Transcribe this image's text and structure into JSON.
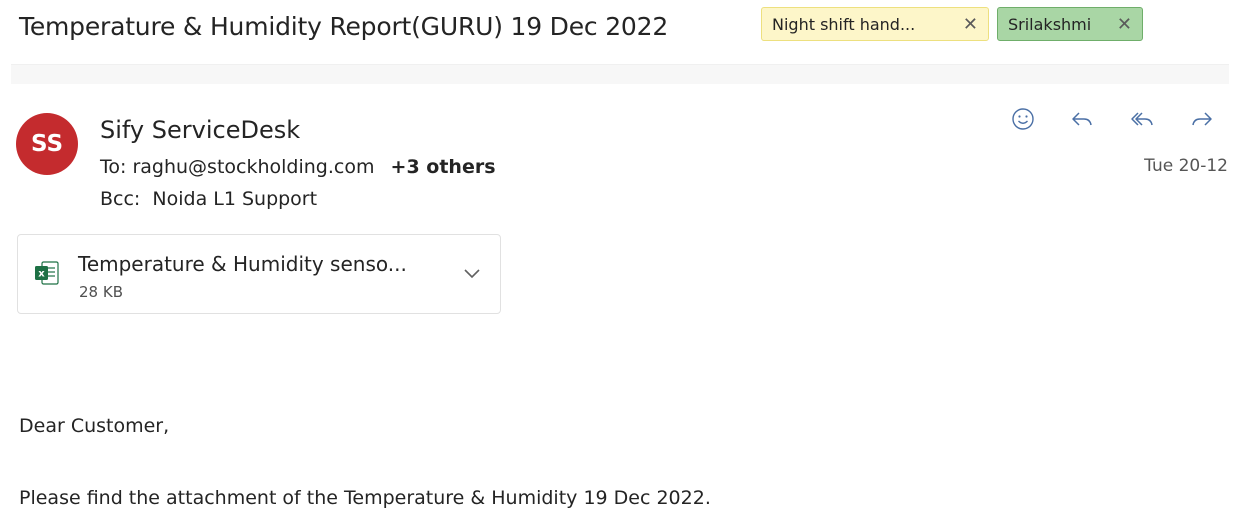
{
  "email": {
    "subject": "Temperature & Humidity Report(GURU) 19 Dec 2022",
    "categories": [
      {
        "label": "Night shift hand...",
        "color": "#fdf6c9"
      },
      {
        "label": "Srilakshmi",
        "color": "#a9d6a5"
      }
    ],
    "sender": {
      "initials": "SS",
      "name": "Sify ServiceDesk",
      "avatar_color": "#c42b2e"
    },
    "to_label": "To:",
    "to_address": "raghu@stockholding.com",
    "to_others": "+3 others",
    "bcc_label": "Bcc:",
    "bcc_value": "Noida L1 Support",
    "date": "Tue 20-12",
    "actions": [
      "smiley-icon",
      "reply-icon",
      "reply-all-icon",
      "forward-icon"
    ],
    "attachment": {
      "name": "Temperature & Humidity senso...",
      "size": "28 KB",
      "icon": "excel-file-icon"
    },
    "body": {
      "greeting": "Dear Customer,",
      "line1": "Please find the attachment of the Temperature & Humidity 19 Dec 2022."
    }
  }
}
